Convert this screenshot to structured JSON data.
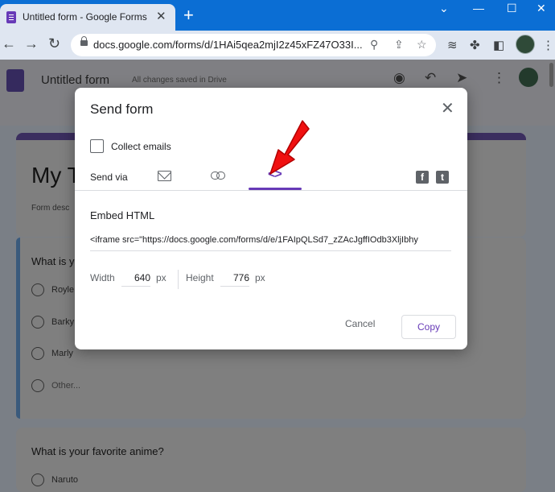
{
  "browser": {
    "tab_title": "Untitled form - Google Forms",
    "tab_close": "✕",
    "new_tab": "+",
    "window_controls": [
      "⌄",
      "—",
      "☐",
      "✕"
    ],
    "url": "docs.google.com/forms/d/1HAi5qea2mjI2z45xFZ47O33I..."
  },
  "forms": {
    "title": "Untitled form",
    "save_status": "All changes saved in Drive",
    "form_title": "My T",
    "form_description": "Form desc",
    "questions": [
      {
        "text": "What is y",
        "options": [
          "Royle",
          "Barky",
          "Marly",
          "Other..."
        ]
      },
      {
        "text": "What is your favorite anime?",
        "options": [
          "Naruto"
        ]
      }
    ]
  },
  "dialog": {
    "title": "Send form",
    "close": "✕",
    "collect_emails_label": "Collect emails",
    "send_via_label": "Send via",
    "embed_tab_icon": "<>",
    "facebook_icon": "f",
    "twitter_icon": "t",
    "embed_heading": "Embed HTML",
    "embed_code": "<iframe src=\"https://docs.google.com/forms/d/e/1FAIpQLSd7_zZAcJgffIOdb3XljIbhy",
    "width_label": "Width",
    "width_value": "640",
    "height_label": "Height",
    "height_value": "776",
    "unit": "px",
    "cancel_label": "Cancel",
    "copy_label": "Copy"
  },
  "colors": {
    "accent": "#673ab7",
    "browser_blue": "#0b6ed4",
    "annotation_red": "#f01010"
  }
}
